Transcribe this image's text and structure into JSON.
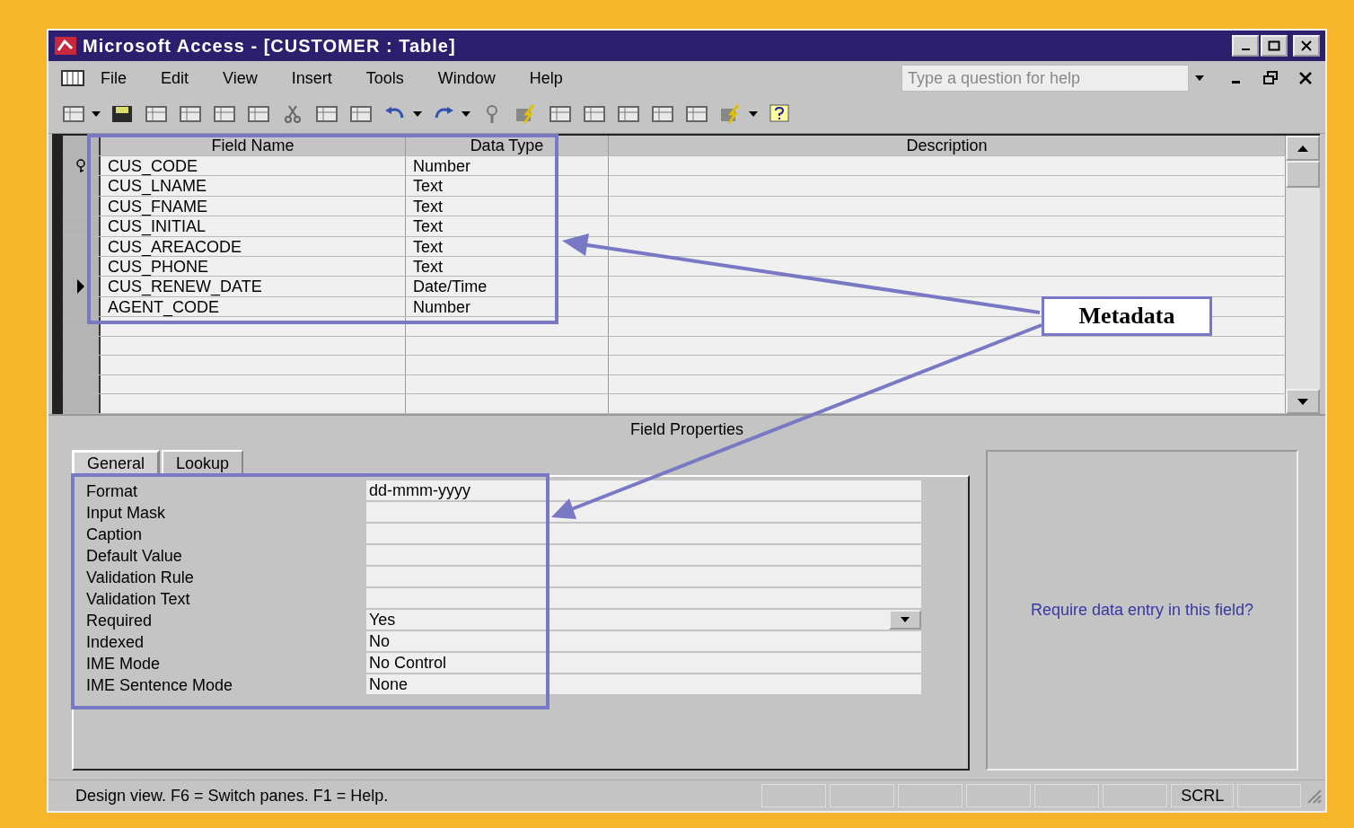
{
  "window": {
    "title": "Microsoft Access - [CUSTOMER : Table]"
  },
  "menu": [
    "File",
    "Edit",
    "View",
    "Insert",
    "Tools",
    "Window",
    "Help"
  ],
  "help_box": {
    "placeholder": "Type a question for help"
  },
  "table": {
    "columns": [
      "Field Name",
      "Data Type",
      "Description"
    ],
    "rows": [
      {
        "field_name": "CUS_CODE",
        "data_type": "Number",
        "primary_key": true,
        "current": false
      },
      {
        "field_name": "CUS_LNAME",
        "data_type": "Text",
        "primary_key": false,
        "current": false
      },
      {
        "field_name": "CUS_FNAME",
        "data_type": "Text",
        "primary_key": false,
        "current": false
      },
      {
        "field_name": "CUS_INITIAL",
        "data_type": "Text",
        "primary_key": false,
        "current": false
      },
      {
        "field_name": "CUS_AREACODE",
        "data_type": "Text",
        "primary_key": false,
        "current": false
      },
      {
        "field_name": "CUS_PHONE",
        "data_type": "Text",
        "primary_key": false,
        "current": false
      },
      {
        "field_name": "CUS_RENEW_DATE",
        "data_type": "Date/Time",
        "primary_key": false,
        "current": true
      },
      {
        "field_name": "AGENT_CODE",
        "data_type": "Number",
        "primary_key": false,
        "current": false
      }
    ]
  },
  "field_properties": {
    "title": "Field Properties",
    "tabs": [
      {
        "label": "General",
        "selected": true
      },
      {
        "label": "Lookup",
        "selected": false
      }
    ],
    "properties": [
      {
        "label": "Format",
        "value": "dd-mmm-yyyy",
        "dropdown": false
      },
      {
        "label": "Input Mask",
        "dropdown": false
      },
      {
        "label": "Caption",
        "dropdown": false
      },
      {
        "label": "Default Value",
        "dropdown": false
      },
      {
        "label": "Validation Rule",
        "dropdown": false
      },
      {
        "label": "Validation Text",
        "dropdown": false
      },
      {
        "label": "Required",
        "value": "Yes",
        "dropdown": true
      },
      {
        "label": "Indexed",
        "value": "No",
        "dropdown": false
      },
      {
        "label": "IME Mode",
        "value": "No Control",
        "dropdown": false
      },
      {
        "label": "IME Sentence Mode",
        "value": "None",
        "dropdown": false
      }
    ],
    "help_text": "Require data entry in this field?"
  },
  "status_bar": {
    "message": "Design view.  F6 = Switch panes.  F1 = Help.",
    "indicator": "SCRL"
  },
  "annotation": {
    "label": "Metadata"
  }
}
